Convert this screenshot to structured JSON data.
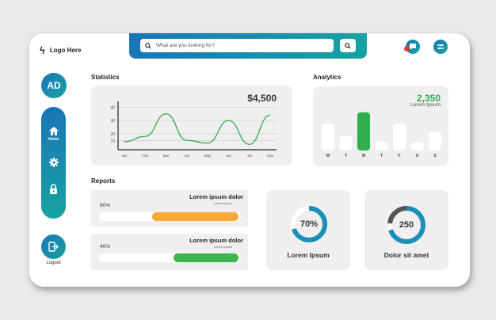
{
  "app": {
    "logo_mark": "ϟ",
    "logo_text": "Logo Here"
  },
  "search": {
    "placeholder": "What are you looking for?"
  },
  "header_icons": [
    "chat-icon",
    "settings-sliders-icon"
  ],
  "user": {
    "initials": "AD"
  },
  "nav": {
    "items": [
      {
        "label": "Home",
        "icon": "home-icon"
      },
      {
        "label": "",
        "icon": "gear-icon"
      },
      {
        "label": "",
        "icon": "lock-icon"
      }
    ],
    "logout_label": "Logout"
  },
  "statistics": {
    "title": "Statistics",
    "amount": "$4,500",
    "chart_data": {
      "type": "line",
      "categories": [
        "Jan",
        "Feb",
        "Mar",
        "Apr",
        "May",
        "Jun",
        "Jul",
        "Sep"
      ],
      "values": [
        14,
        18,
        35,
        15,
        13,
        30,
        12,
        34
      ],
      "yticks": [
        15,
        20,
        30,
        40
      ],
      "ylim": [
        8,
        42
      ],
      "title": "",
      "xlabel": "",
      "ylabel": "",
      "grid": true,
      "color": "#2fae4a"
    }
  },
  "analytics": {
    "title": "Analytics",
    "value": "2,350",
    "subtitle": "Lorem Ipsum",
    "chart_data": {
      "type": "bar",
      "categories": [
        "M",
        "T",
        "W",
        "T",
        "F",
        "S",
        "S"
      ],
      "values": [
        36,
        19,
        51,
        12,
        36,
        11,
        25
      ],
      "highlight_index": 2,
      "ylim": [
        0,
        55
      ],
      "title": "",
      "xlabel": "",
      "ylabel": "",
      "colors": {
        "default": "#ffffff",
        "highlight": "#2fae4a"
      }
    }
  },
  "reports": {
    "title": "Reports",
    "items": [
      {
        "title": "Lorem ipsum dolor",
        "subtitle": "Lorem ipsum",
        "percent_label": "60%",
        "progress": 0.6,
        "color": "#f7a836"
      },
      {
        "title": "Lorem ipsum dolor",
        "subtitle": "Lorem ipsum",
        "percent_label": "40%",
        "progress": 0.4,
        "color": "#3cb54a"
      }
    ]
  },
  "rings": [
    {
      "value": "70%",
      "label": "Lorem Ipsum",
      "fraction": 0.7,
      "color": "#1a8fb8"
    },
    {
      "value": "250",
      "label": "Dolor sit amet",
      "fraction": 0.7,
      "color": "#1a8fb8"
    }
  ],
  "colors": {
    "accent_start": "#1a75b8",
    "accent_end": "#17a3a0",
    "green": "#2fae4a"
  }
}
